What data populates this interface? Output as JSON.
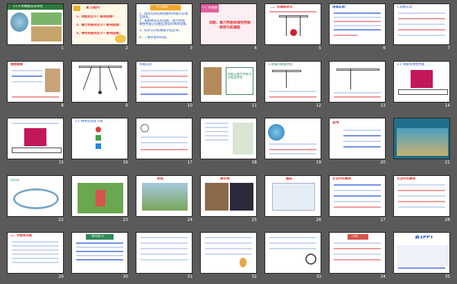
{
  "slides": [
    {
      "n": "1",
      "header": "11.4 机械能及其转化"
    },
    {
      "n": "2",
      "header": "复习提问",
      "lines": [
        "1、动能的定义？影响因素？",
        "2、重力势能的定义？影响因素？",
        "3、弹性势能的定义？影响因素？"
      ]
    },
    {
      "n": "3",
      "header": "学习目标",
      "lines": [
        "1、能用实例说明动能和势能可以相互转化。",
        "2、能解释常见的动能、重力势能、弹性势能之间相互转化的简单现象。",
        "3、初步认识机械能守恒定律。",
        "4、了解水能和风能。"
      ]
    },
    {
      "n": "4",
      "header": "一、机械能",
      "lines": [
        "动能、重力势能和弹性势能统称为机械能"
      ]
    },
    {
      "n": "5",
      "header": "二、机械能转化"
    },
    {
      "n": "6",
      "header": "滚摆实验："
    },
    {
      "n": "7",
      "header": "1.观察实验"
    },
    {
      "n": "8",
      "header": "想想做做"
    },
    {
      "n": "9",
      "header": ""
    },
    {
      "n": "10",
      "header": "单摆实验："
    },
    {
      "n": "11",
      "header": "动能与重力势能可以相互转化"
    },
    {
      "n": "12",
      "header": "3.单摆的能量转化"
    },
    {
      "n": "13",
      "header": ""
    },
    {
      "n": "14",
      "header": "2.1 动能和弹性势能"
    },
    {
      "n": "15",
      "header": ""
    },
    {
      "n": "16",
      "header": "3.1 物体从高处下落"
    },
    {
      "n": "17",
      "header": ""
    },
    {
      "n": "18",
      "header": ""
    },
    {
      "n": "19",
      "header": ""
    },
    {
      "n": "20",
      "header": "思考"
    },
    {
      "n": "21",
      "header": ""
    },
    {
      "n": "22",
      "header": "过山车"
    },
    {
      "n": "23",
      "header": ""
    },
    {
      "n": "24",
      "header": "射箭"
    },
    {
      "n": "25",
      "header": "撑竿跳"
    },
    {
      "n": "26",
      "header": "蹦床"
    },
    {
      "n": "27",
      "header": "生活中的事例"
    },
    {
      "n": "28",
      "header": "生活中的事例"
    },
    {
      "n": "29",
      "header": "三、水能和风能"
    },
    {
      "n": "30",
      "header": "课堂练习"
    },
    {
      "n": "31",
      "header": ""
    },
    {
      "n": "32",
      "header": ""
    },
    {
      "n": "33",
      "header": ""
    },
    {
      "n": "34",
      "header": "小结"
    },
    {
      "n": "35",
      "header": "第1PPT"
    }
  ],
  "colors": {
    "background": "#5a5a5a",
    "accent_red": "#e03030",
    "accent_blue": "#2356c8",
    "header_green": "#2e8b57"
  }
}
